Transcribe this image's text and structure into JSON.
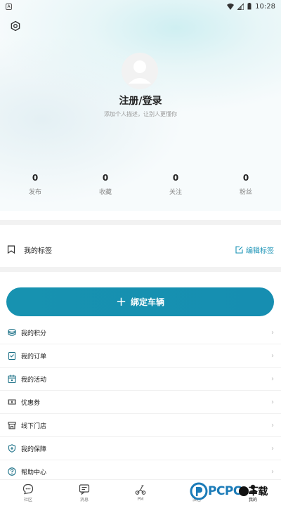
{
  "status_bar": {
    "left_icon": "A",
    "time": "10:28"
  },
  "profile": {
    "login_title": "注册/登录",
    "login_desc": "添加个人描述，让别人更懂你"
  },
  "stats": [
    {
      "value": "0",
      "label": "发布"
    },
    {
      "value": "0",
      "label": "收藏"
    },
    {
      "value": "0",
      "label": "关注"
    },
    {
      "value": "0",
      "label": "粉丝"
    }
  ],
  "tags": {
    "label": "我的标签",
    "edit_label": "编辑标签"
  },
  "bind_button": {
    "plus": "+",
    "label": "绑定车辆"
  },
  "menu": [
    {
      "label": "我的积分",
      "icon": "points-icon"
    },
    {
      "label": "我的订单",
      "icon": "order-icon"
    },
    {
      "label": "我的活动",
      "icon": "calendar-icon"
    },
    {
      "label": "优惠券",
      "icon": "coupon-icon"
    },
    {
      "label": "线下门店",
      "icon": "store-icon"
    },
    {
      "label": "我的保障",
      "icon": "shield-icon"
    },
    {
      "label": "帮助中心",
      "icon": "help-icon"
    }
  ],
  "tabs": [
    {
      "label": "社区",
      "icon": "community-icon"
    },
    {
      "label": "消息",
      "icon": "message-icon"
    },
    {
      "label": "PM",
      "icon": "scooter-icon"
    },
    {
      "label": "派包",
      "icon": "package-icon"
    },
    {
      "label": "我的",
      "icon": "profile-icon"
    }
  ],
  "watermark": {
    "text": "PCPO",
    "suffix": "下载"
  },
  "colors": {
    "accent": "#1792b0",
    "divider": "#f2f2f2"
  }
}
